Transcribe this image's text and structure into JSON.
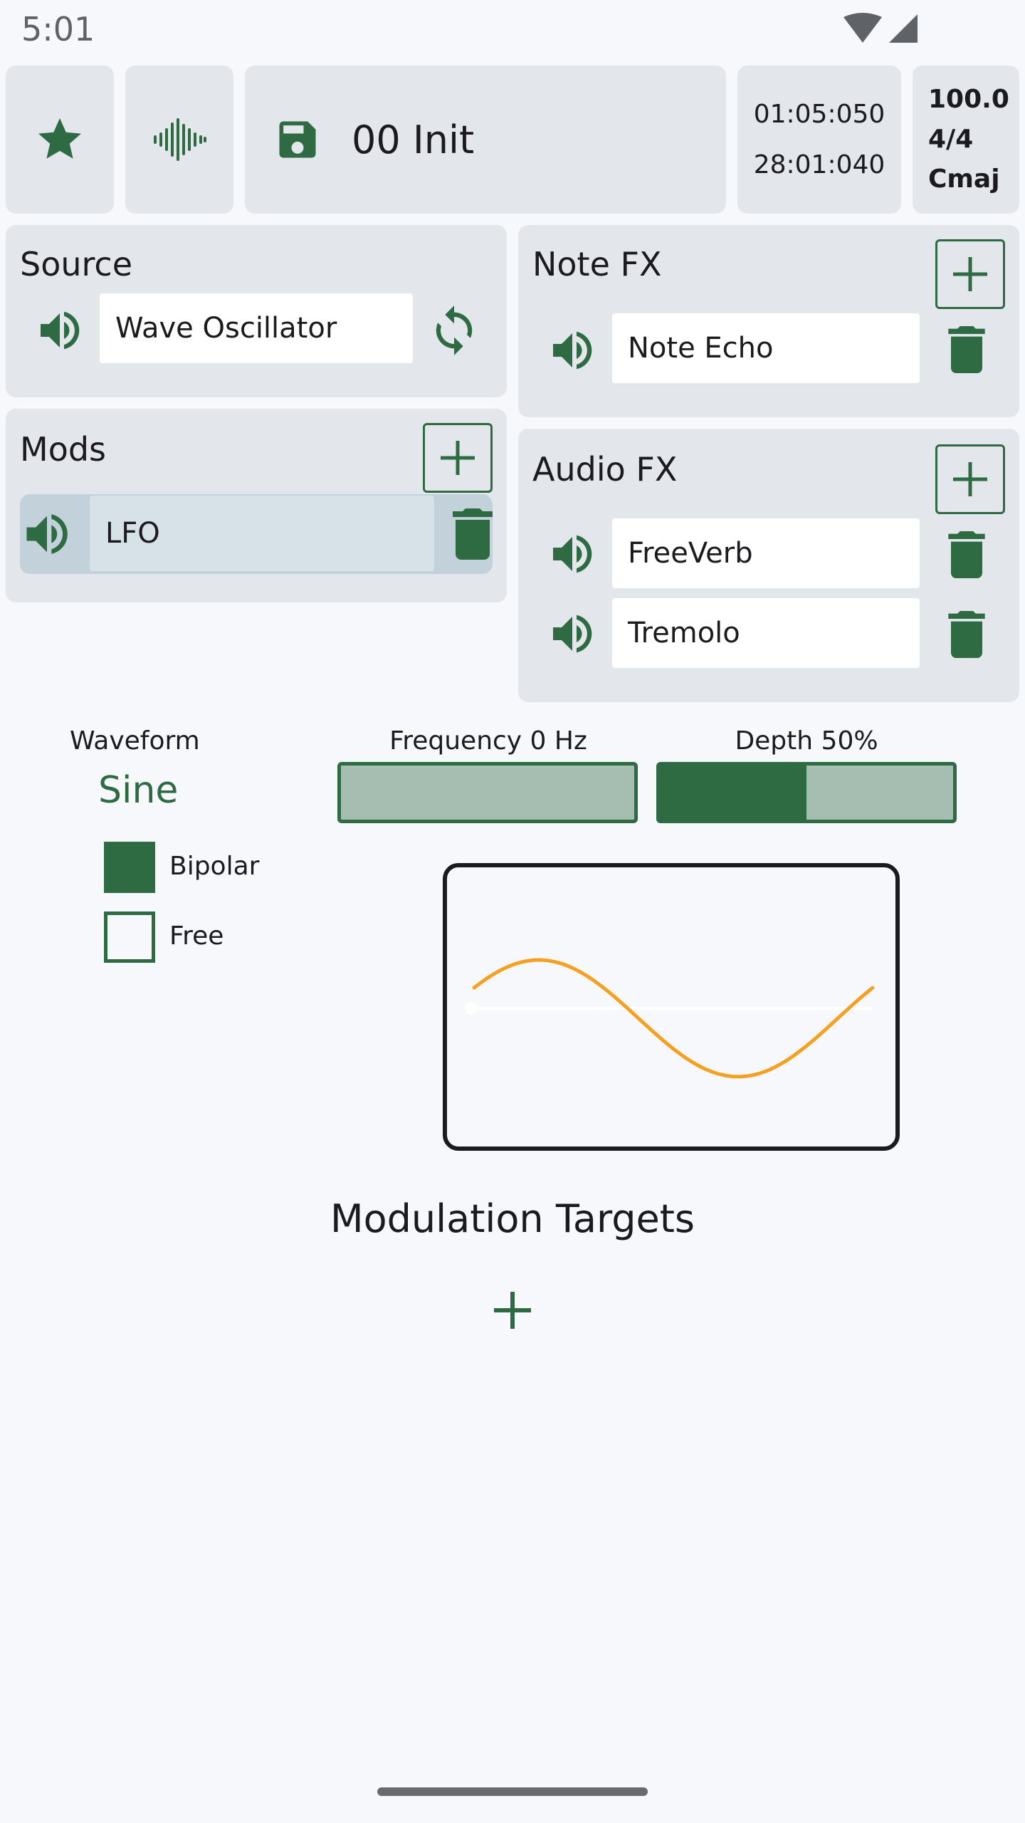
{
  "status": {
    "time": "5:01"
  },
  "toolbar": {
    "preset_name": "00 Init",
    "time_position": "01:05:050",
    "time_length": "28:01:040",
    "tempo": "100.0",
    "meter": "4/4",
    "key": "Cmaj"
  },
  "source": {
    "title": "Source",
    "name": "Wave Oscillator"
  },
  "note_fx": {
    "title": "Note FX",
    "items": [
      {
        "name": "Note Echo"
      }
    ]
  },
  "mods": {
    "title": "Mods",
    "items": [
      {
        "name": "LFO"
      }
    ]
  },
  "audio_fx": {
    "title": "Audio FX",
    "items": [
      {
        "name": "FreeVerb"
      },
      {
        "name": "Tremolo"
      }
    ]
  },
  "lfo": {
    "waveform_label": "Waveform",
    "waveform_value": "Sine",
    "bipolar_label": "Bipolar",
    "bipolar_checked": true,
    "free_label": "Free",
    "free_checked": false,
    "frequency_label": "Frequency 0 Hz",
    "frequency_fraction": 0.0,
    "depth_label": "Depth 50%",
    "depth_fraction": 0.5
  },
  "modulation": {
    "title": "Modulation Targets"
  },
  "colors": {
    "accent": "#2e6b43",
    "panel": "#e3e6ea",
    "wave": "#f5a020"
  }
}
